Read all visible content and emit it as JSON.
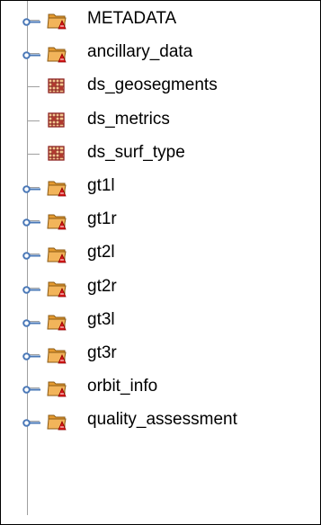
{
  "tree": {
    "items": [
      {
        "label": "METADATA",
        "type": "group",
        "expandable": true
      },
      {
        "label": "ancillary_data",
        "type": "group",
        "expandable": true
      },
      {
        "label": "ds_geosegments",
        "type": "dataset",
        "expandable": false
      },
      {
        "label": "ds_metrics",
        "type": "dataset",
        "expandable": false
      },
      {
        "label": "ds_surf_type",
        "type": "dataset",
        "expandable": false
      },
      {
        "label": "gt1l",
        "type": "group",
        "expandable": true
      },
      {
        "label": "gt1r",
        "type": "group",
        "expandable": true
      },
      {
        "label": "gt2l",
        "type": "group",
        "expandable": true
      },
      {
        "label": "gt2r",
        "type": "group",
        "expandable": true
      },
      {
        "label": "gt3l",
        "type": "group",
        "expandable": true
      },
      {
        "label": "gt3r",
        "type": "group",
        "expandable": true
      },
      {
        "label": "orbit_info",
        "type": "group",
        "expandable": true
      },
      {
        "label": "quality_assessment",
        "type": "group",
        "expandable": true
      }
    ]
  },
  "icons": {
    "group": "folder-group-icon",
    "dataset": "dataset-grid-icon",
    "expand": "expand-handle-icon"
  },
  "colors": {
    "folder_fill": "#f2b45a",
    "folder_tab": "#e59a2f",
    "folder_outline": "#8a5a14",
    "group_badge": "#d81818",
    "dataset_grid": "#8b2020",
    "dataset_fill": "#f3c78f",
    "handle_stem": "#4a78b7",
    "connector": "#a0a0a0"
  }
}
